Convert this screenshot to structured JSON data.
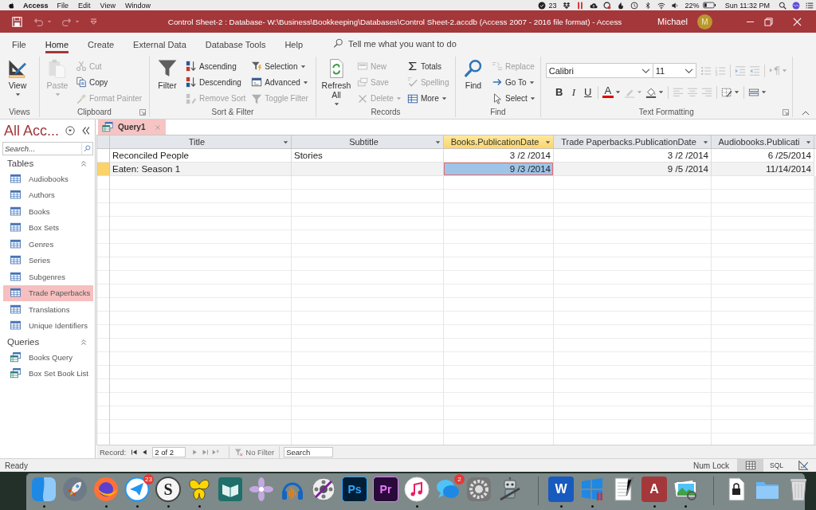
{
  "menu_bar": {
    "app": "Access",
    "menus": [
      "File",
      "Edit",
      "View",
      "Window"
    ],
    "count": "23",
    "battery": "22%",
    "clock": "Sun 11:32 PM"
  },
  "title_bar": {
    "quick_access": [
      {
        "disabled": false,
        "dropdown": false
      },
      {
        "disabled": true,
        "dropdown": true
      },
      {
        "disabled": true,
        "dropdown": true
      }
    ],
    "title": "Control Sheet-2 : Database- W:\\Business\\Bookkeeping\\Databases\\Control Sheet-2.accdb (Access 2007 - 2016 file format) - Access",
    "user": "Michael",
    "avatar": "M"
  },
  "ribbon": {
    "tabs": [
      {
        "label": "File",
        "selected": false
      },
      {
        "label": "Home",
        "selected": true
      },
      {
        "label": "Create",
        "selected": false
      },
      {
        "label": "External Data",
        "selected": false
      },
      {
        "label": "Database Tools",
        "selected": false
      },
      {
        "label": "Help",
        "selected": false
      }
    ],
    "tell_me": {
      "placeholder": "Tell me what you want to do"
    },
    "groups": [
      {
        "label": "Views",
        "launcher": false,
        "large": [
          {
            "label": "View",
            "disabled": false,
            "dropdown": true
          }
        ]
      },
      {
        "label": "Clipboard",
        "launcher": true,
        "large": [
          {
            "label": "Paste",
            "disabled": true,
            "dropdown": true
          }
        ],
        "columns": [
          [
            {
              "label": "Cut",
              "disabled": true,
              "dropdown": false
            },
            {
              "label": "Copy",
              "disabled": false,
              "dropdown": false
            },
            {
              "label": "Format Painter",
              "disabled": true,
              "dropdown": false
            }
          ]
        ]
      },
      {
        "label": "Sort & Filter",
        "launcher": false,
        "large": [
          {
            "label": "Filter",
            "disabled": false,
            "dropdown": false
          }
        ],
        "columns": [
          [
            {
              "label": "Ascending",
              "disabled": false,
              "dropdown": false
            },
            {
              "label": "Descending",
              "disabled": false,
              "dropdown": false
            },
            {
              "label": "Remove Sort",
              "disabled": true,
              "dropdown": false
            }
          ],
          [
            {
              "label": "Selection",
              "disabled": false,
              "dropdown": true
            },
            {
              "label": "Advanced",
              "disabled": false,
              "dropdown": true
            },
            {
              "label": "Toggle Filter",
              "disabled": true,
              "dropdown": false
            }
          ]
        ]
      },
      {
        "label": "Records",
        "launcher": false,
        "large": [
          {
            "label": "Refresh All",
            "disabled": false,
            "dropdown": true
          }
        ],
        "columns": [
          [
            {
              "label": "New",
              "disabled": true,
              "dropdown": false
            },
            {
              "label": "Save",
              "disabled": true,
              "dropdown": false
            },
            {
              "label": "Delete",
              "disabled": true,
              "dropdown": true
            }
          ],
          [
            {
              "label": "Totals",
              "disabled": false,
              "dropdown": false
            },
            {
              "label": "Spelling",
              "disabled": true,
              "dropdown": false
            },
            {
              "label": "More",
              "disabled": false,
              "dropdown": true
            }
          ]
        ]
      },
      {
        "label": "Find",
        "launcher": false,
        "large": [
          {
            "label": "Find",
            "disabled": false,
            "dropdown": false
          }
        ],
        "columns": [
          [
            {
              "label": "Replace",
              "disabled": true,
              "dropdown": false
            },
            {
              "label": "Go To",
              "disabled": false,
              "dropdown": true
            },
            {
              "label": "Select",
              "disabled": false,
              "dropdown": true
            }
          ]
        ]
      }
    ],
    "text_formatting": {
      "label": "Text Formatting",
      "launcher": true,
      "font": {
        "value": "Calibri"
      },
      "size": {
        "value": "11"
      },
      "row_1": [
        {
          "disabled": true,
          "dropdown": false
        },
        {
          "disabled": true,
          "dropdown": false
        },
        {
          "disabled": true,
          "dropdown": false
        },
        {
          "disabled": true,
          "dropdown": false
        },
        {
          "disabled": true,
          "dropdown": true
        }
      ],
      "row_2": [
        {
          "label": "B",
          "disabled": false,
          "dropdown": false
        },
        {
          "label": "I",
          "disabled": false,
          "dropdown": false
        },
        {
          "label": "U",
          "disabled": false,
          "dropdown": false
        },
        {
          "label": "A",
          "disabled": false,
          "dropdown": true
        },
        {
          "disabled": true,
          "dropdown": true
        },
        {
          "disabled": false,
          "dropdown": true
        },
        {
          "disabled": true,
          "dropdown": false
        },
        {
          "disabled": true,
          "dropdown": false
        },
        {
          "disabled": true,
          "dropdown": false
        },
        {
          "disabled": false,
          "dropdown": true
        },
        {
          "disabled": false,
          "dropdown": true
        }
      ]
    }
  },
  "nav_pane": {
    "title": "All Acc...",
    "search": {
      "placeholder": "Search..."
    },
    "sections": [
      {
        "label": "Tables",
        "kind": "table",
        "expanded": true,
        "items": [
          {
            "label": "Audiobooks",
            "selected": false
          },
          {
            "label": "Authors",
            "selected": false
          },
          {
            "label": "Books",
            "selected": false
          },
          {
            "label": "Box Sets",
            "selected": false
          },
          {
            "label": "Genres",
            "selected": false
          },
          {
            "label": "Series",
            "selected": false
          },
          {
            "label": "Subgenres",
            "selected": false
          },
          {
            "label": "Trade Paperbacks",
            "selected": true
          },
          {
            "label": "Translations",
            "selected": false
          },
          {
            "label": "Unique Identifiers",
            "selected": false
          }
        ]
      },
      {
        "label": "Queries",
        "kind": "query",
        "expanded": true,
        "items": [
          {
            "label": "Books Query",
            "selected": false
          },
          {
            "label": "Box Set Book List",
            "selected": false
          }
        ]
      }
    ]
  },
  "document_tabs": [
    {
      "label": "Query1",
      "selected": true
    }
  ],
  "datasheet": {
    "columns": [
      {
        "label": "Title",
        "kind": "text",
        "selected": false
      },
      {
        "label": "Subtitle",
        "kind": "text",
        "selected": false
      },
      {
        "label": "Books.PublicationDate",
        "kind": "date",
        "selected": true
      },
      {
        "label": "Trade Paperbacks.PublicationDate",
        "kind": "date",
        "selected": false
      },
      {
        "label": "Audiobooks.Publicati",
        "kind": "date",
        "selected": false
      }
    ],
    "rows": [
      {
        "selected": false,
        "cells": [
          "Reconciled People",
          "Stories",
          "3 /2 /2014",
          "3 /2 /2014",
          "6 /25/2014"
        ]
      },
      {
        "selected": true,
        "cells": [
          "Eaten: Season 1",
          null,
          "9 /3 /2014",
          "9 /5 /2014",
          "11/14/2014"
        ]
      }
    ]
  },
  "record_nav": {
    "label": "Record:",
    "buttons_before": [
      {
        "disabled": false
      },
      {
        "disabled": false
      }
    ],
    "position": {
      "value": "2 of 2"
    },
    "buttons_after": [
      {
        "disabled": true
      },
      {
        "disabled": true
      },
      {
        "disabled": true
      }
    ],
    "filter": {
      "label": "No Filter",
      "disabled": true
    },
    "search": {
      "placeholder": "Search"
    }
  },
  "status_bar": {
    "text": "Ready",
    "num_lock": "Num Lock",
    "views": [
      {
        "selected": true
      },
      {
        "label": "SQL",
        "selected": false
      },
      {
        "selected": false
      }
    ]
  },
  "dock": {
    "groups": [
      [
        {
          "running": true
        },
        {
          "running": false
        },
        {
          "running": true
        },
        {
          "running": true,
          "badge": "23"
        },
        {
          "running": true,
          "label": "S"
        },
        {
          "running": true
        },
        {
          "running": false
        },
        {
          "running": false
        },
        {
          "running": false
        },
        {
          "running": false
        },
        {
          "running": false,
          "label": "Ps"
        },
        {
          "running": false,
          "label": "Pr"
        },
        {
          "running": true
        },
        {
          "running": false,
          "badge": "2"
        },
        {
          "running": false
        },
        {
          "running": false
        }
      ],
      [
        {
          "running": true,
          "label": "W"
        },
        {
          "running": true
        },
        {
          "running": false
        },
        {
          "running": true,
          "label": "A"
        },
        {
          "running": true
        }
      ],
      [
        {
          "running": false
        },
        {
          "running": false
        },
        {
          "running": false
        }
      ]
    ]
  }
}
